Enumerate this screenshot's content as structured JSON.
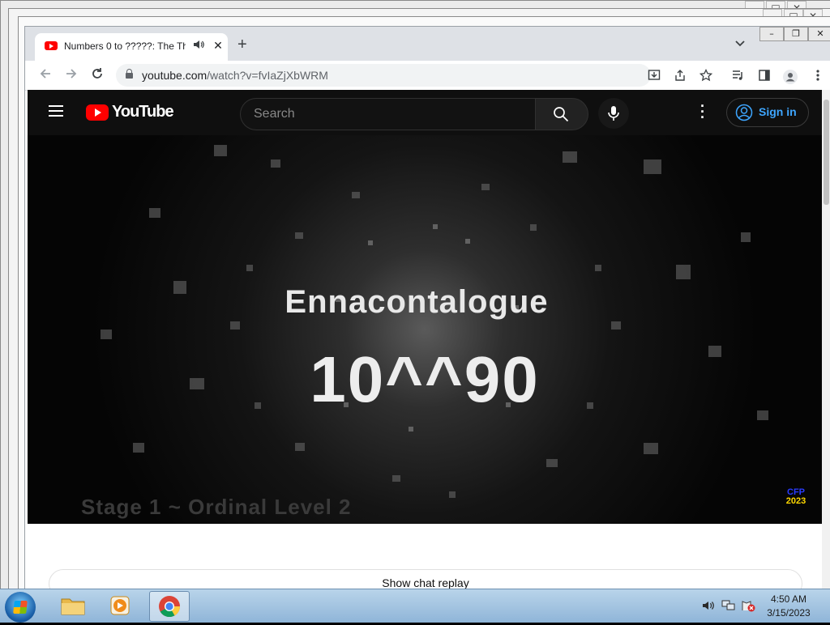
{
  "browser": {
    "tab": {
      "title": "Numbers 0 to ?????: The Thi",
      "audio_icon": "speaker-icon",
      "close_glyph": "✕"
    },
    "new_tab_glyph": "+",
    "tab_menu_glyph": "⌄",
    "address": {
      "host": "youtube.com",
      "path": "/watch?v=fvIaZjXbWRM"
    },
    "toolbar_icons": [
      "back-icon",
      "forward-icon",
      "reload-icon",
      "install-icon",
      "share-icon",
      "star-icon",
      "media-icon",
      "sidepanel-icon",
      "profile-icon",
      "menu-icon"
    ]
  },
  "youtube": {
    "logo_text": "YouTube",
    "search_placeholder": "Search",
    "sign_in": "Sign in",
    "video": {
      "title_line": "Ennacontalogue",
      "number_line": "10^^90",
      "subtitle": "Stage 1 ~ Ordinal Level 2",
      "watermark_top": "CFP",
      "watermark_bottom": "2023"
    },
    "chat_button": "Show chat replay"
  },
  "taskbar": {
    "clock_time": "4:50 AM",
    "clock_date": "3/15/2023"
  },
  "colors": {
    "yt_red": "#ff0000",
    "yt_dark": "#0f0f0f",
    "link_blue": "#3ea6ff",
    "taskbar": "#9fc1e0"
  }
}
